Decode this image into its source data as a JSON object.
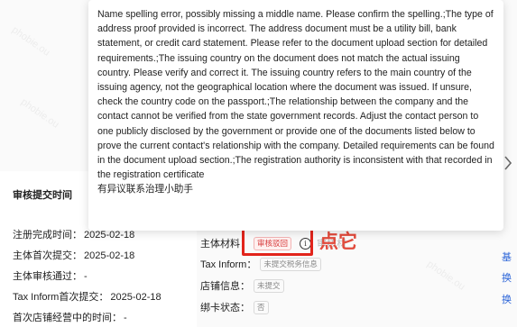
{
  "tooltip": {
    "message": "Name spelling error, possibly missing a middle name. Please confirm the spelling.;The type of address proof provided is incorrect. The address document must be a utility bill, bank statement, or credit card statement. Please refer to the document upload section for detailed requirements.;The issuing country on the document does not match the actual issuing country. Please verify and correct it. The issuing country refers to the main country of the issuing agency, not the geographical location where the document was issued. If unsure, check the country code on the passport.;The relationship between the company and the contact cannot be verified from the state government records. Adjust the contact person to one publicly disclosed by the government or provide one of the documents listed below to prove the current contact's relationship with the company. Detailed requirements can be found in the document upload section.;The registration authority is inconsistent with that recorded in the registration certificate",
    "contact_note": "有异议联系治理小助手"
  },
  "left_panel": {
    "title": "审核提交时间",
    "rows": [
      {
        "label": "注册完成时间：",
        "value": "2025-02-18"
      },
      {
        "label": "主体首次提交：",
        "value": "2025-02-18"
      },
      {
        "label": "主体审核通过：",
        "value": "-"
      },
      {
        "label": "Tax Inform首次提交：",
        "value": "2025-02-18"
      },
      {
        "label": "首次店铺经营中的时间：",
        "value": "-"
      }
    ]
  },
  "status_panel": {
    "entity_material": {
      "label": "主体材料：",
      "tag": "审核驳回",
      "faded": "审核材"
    },
    "tax_inform": {
      "label": "Tax Inform：",
      "tag": "未提交税务信息"
    },
    "store_info": {
      "label": "店铺信息：",
      "tag": "未提交"
    },
    "card_status": {
      "label": "绑卡状态：",
      "tag": "否"
    }
  },
  "annotation": {
    "text": "点它"
  },
  "side_links": [
    "基",
    "换",
    "换"
  ],
  "colors": {
    "highlight": "#e2241b",
    "annotation": "#e24a3b",
    "rejected_tag": "#d6393a",
    "link": "#2b64d8"
  }
}
